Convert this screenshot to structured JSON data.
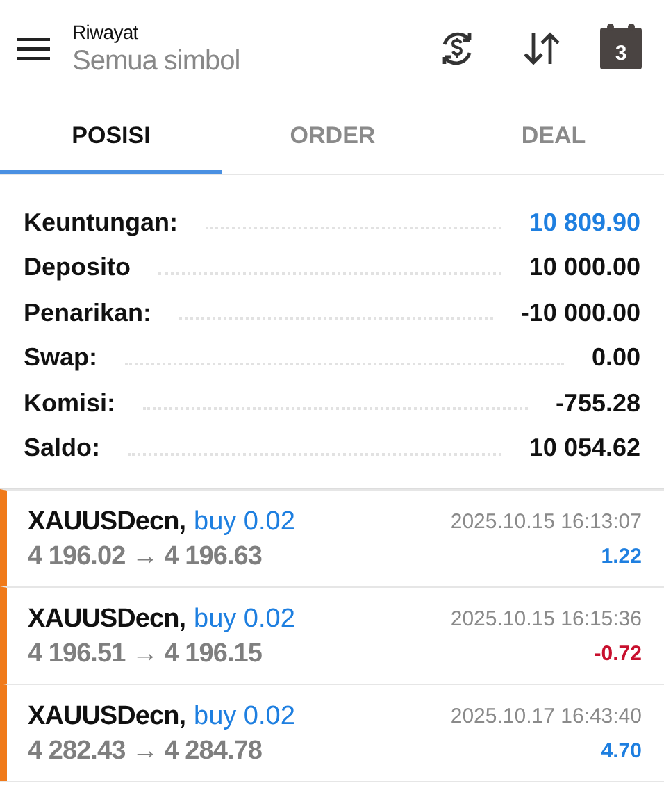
{
  "header": {
    "title": "Riwayat",
    "subtitle": "Semua simbol",
    "calendar_day": "3"
  },
  "tabs": [
    {
      "label": "POSISI",
      "selected": true
    },
    {
      "label": "ORDER",
      "selected": false
    },
    {
      "label": "DEAL",
      "selected": false
    }
  ],
  "summary": [
    {
      "label": "Keuntungan:",
      "value": "10 809.90",
      "color": "#1e7fe0"
    },
    {
      "label": "Deposito",
      "value": "10 000.00",
      "color": "#111111"
    },
    {
      "label": "Penarikan:",
      "value": "-10 000.00",
      "color": "#111111"
    },
    {
      "label": "Swap:",
      "value": "0.00",
      "color": "#111111"
    },
    {
      "label": "Komisi:",
      "value": "-755.28",
      "color": "#111111"
    },
    {
      "label": "Saldo:",
      "value": "10 054.62",
      "color": "#111111"
    }
  ],
  "positions": [
    {
      "symbol": "XAUUSDecn,",
      "side": "buy 0.02",
      "prices": "4 196.02 → 4 196.63",
      "time": "2025.10.15 16:13:07",
      "profit": "1.22",
      "color": "#1e7fe0"
    },
    {
      "symbol": "XAUUSDecn,",
      "side": "buy 0.02",
      "prices": "4 196.51 → 4 196.15",
      "time": "2025.10.15 16:15:36",
      "profit": "-0.72",
      "color": "#c8102e"
    },
    {
      "symbol": "XAUUSDecn,",
      "side": "buy 0.02",
      "prices": "4 282.43 → 4 284.78",
      "time": "2025.10.17 16:43:40",
      "profit": "4.70",
      "color": "#1e7fe0"
    }
  ]
}
